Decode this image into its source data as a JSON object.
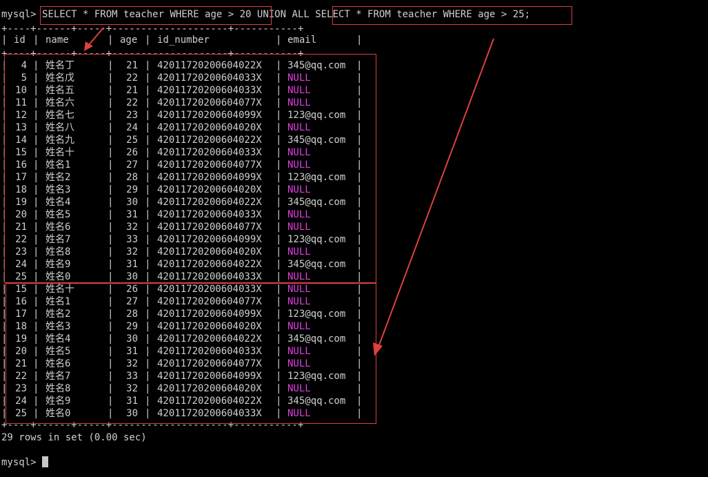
{
  "prompt": "mysql>",
  "query": {
    "part1": "SELECT * FROM teacher WHERE age > 20",
    "union": "UNION ALL",
    "part2": "SELECT * FROM teacher WHERE age > 25;"
  },
  "table": {
    "border": "+----+------+-----+--------------------+-----------+",
    "columns": [
      "id",
      "name",
      "age",
      "id_number",
      "email"
    ],
    "rows": [
      [
        "4",
        "姓名丁",
        "21",
        "42011720200604022X",
        "345@qq.com"
      ],
      [
        "5",
        "姓名戊",
        "22",
        "42011720200604033X",
        "NULL"
      ],
      [
        "10",
        "姓名五",
        "21",
        "42011720200604033X",
        "NULL"
      ],
      [
        "11",
        "姓名六",
        "22",
        "42011720200604077X",
        "NULL"
      ],
      [
        "12",
        "姓名七",
        "23",
        "42011720200604099X",
        "123@qq.com"
      ],
      [
        "13",
        "姓名八",
        "24",
        "42011720200604020X",
        "NULL"
      ],
      [
        "14",
        "姓名九",
        "25",
        "42011720200604022X",
        "345@qq.com"
      ],
      [
        "15",
        "姓名十",
        "26",
        "42011720200604033X",
        "NULL"
      ],
      [
        "16",
        "姓名1",
        "27",
        "42011720200604077X",
        "NULL"
      ],
      [
        "17",
        "姓名2",
        "28",
        "42011720200604099X",
        "123@qq.com"
      ],
      [
        "18",
        "姓名3",
        "29",
        "42011720200604020X",
        "NULL"
      ],
      [
        "19",
        "姓名4",
        "30",
        "42011720200604022X",
        "345@qq.com"
      ],
      [
        "20",
        "姓名5",
        "31",
        "42011720200604033X",
        "NULL"
      ],
      [
        "21",
        "姓名6",
        "32",
        "42011720200604077X",
        "NULL"
      ],
      [
        "22",
        "姓名7",
        "33",
        "42011720200604099X",
        "123@qq.com"
      ],
      [
        "23",
        "姓名8",
        "32",
        "42011720200604020X",
        "NULL"
      ],
      [
        "24",
        "姓名9",
        "31",
        "42011720200604022X",
        "345@qq.com"
      ],
      [
        "25",
        "姓名0",
        "30",
        "42011720200604033X",
        "NULL"
      ],
      [
        "15",
        "姓名十",
        "26",
        "42011720200604033X",
        "NULL"
      ],
      [
        "16",
        "姓名1",
        "27",
        "42011720200604077X",
        "NULL"
      ],
      [
        "17",
        "姓名2",
        "28",
        "42011720200604099X",
        "123@qq.com"
      ],
      [
        "18",
        "姓名3",
        "29",
        "42011720200604020X",
        "NULL"
      ],
      [
        "19",
        "姓名4",
        "30",
        "42011720200604022X",
        "345@qq.com"
      ],
      [
        "20",
        "姓名5",
        "31",
        "42011720200604033X",
        "NULL"
      ],
      [
        "21",
        "姓名6",
        "32",
        "42011720200604077X",
        "NULL"
      ],
      [
        "22",
        "姓名7",
        "33",
        "42011720200604099X",
        "123@qq.com"
      ],
      [
        "23",
        "姓名8",
        "32",
        "42011720200604020X",
        "NULL"
      ],
      [
        "24",
        "姓名9",
        "31",
        "42011720200604022X",
        "345@qq.com"
      ],
      [
        "25",
        "姓名0",
        "30",
        "42011720200604033X",
        "NULL"
      ]
    ]
  },
  "result_summary": "29 rows in set (0.00 sec)",
  "colors": {
    "background": "#000000",
    "text": "#d0d0d0",
    "null": "#e040e0",
    "annotation": "#e04040"
  }
}
